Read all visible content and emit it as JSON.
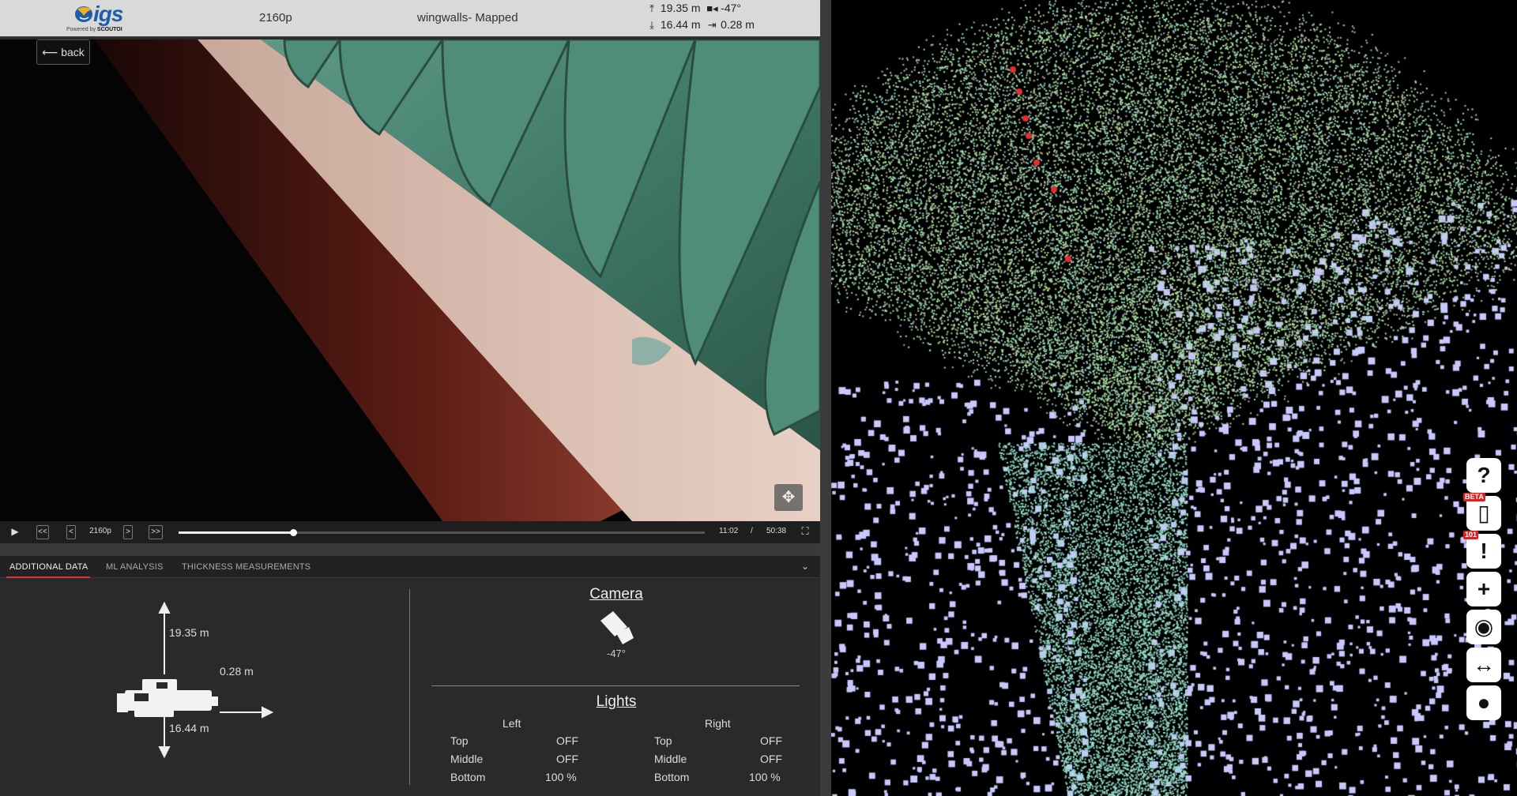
{
  "topbar": {
    "logo_text": "igs",
    "logo_sub_prefix": "Powered by ",
    "logo_sub_brand": "SCOUTOI",
    "resolution": "2160p",
    "title": "wingwalls- Mapped",
    "stats": {
      "up": "19.35 m",
      "camera_angle": "-47°",
      "down": "16.44 m",
      "side": "0.28 m"
    }
  },
  "video": {
    "back_label": "back",
    "move_icon": "move-icon"
  },
  "controls": {
    "play_icon": "▶",
    "rewind_label": "<<",
    "prev_label": "<",
    "resolution_label": "2160p",
    "next_label": ">",
    "forward_label": ">>",
    "progress_fraction": 0.217,
    "current_time": "11:02",
    "separator": "/",
    "total_time": "50:38",
    "fullscreen_icon": "fullscreen-icon"
  },
  "tabs": [
    {
      "label": "ADDITIONAL DATA",
      "active": true
    },
    {
      "label": "ML ANALYSIS",
      "active": false
    },
    {
      "label": "THICKNESS MEASUREMENTS",
      "active": false
    }
  ],
  "additional_data": {
    "up_distance": "19.35 m",
    "side_distance": "0.28 m",
    "down_distance": "16.44 m",
    "camera_title": "Camera",
    "camera_angle": "-47°",
    "lights_title": "Lights",
    "lights": {
      "left_header": "Left",
      "right_header": "Right",
      "left": [
        {
          "name": "Top",
          "value": "OFF"
        },
        {
          "name": "Middle",
          "value": "OFF"
        },
        {
          "name": "Bottom",
          "value": "100 %"
        }
      ],
      "right": [
        {
          "name": "Top",
          "value": "OFF"
        },
        {
          "name": "Middle",
          "value": "OFF"
        },
        {
          "name": "Bottom",
          "value": "100 %"
        }
      ]
    }
  },
  "pointcloud_toolbar": [
    {
      "icon": "help-icon",
      "glyph": "?",
      "badge": ""
    },
    {
      "icon": "map-icon",
      "glyph": "▯",
      "badge": "BETA"
    },
    {
      "icon": "alert-icon",
      "glyph": "!",
      "badge": "101"
    },
    {
      "icon": "add-icon",
      "glyph": "+",
      "badge": ""
    },
    {
      "icon": "eye-icon",
      "glyph": "◉",
      "badge": ""
    },
    {
      "icon": "measure-icon",
      "glyph": "↔",
      "badge": ""
    },
    {
      "icon": "toggle-icon",
      "glyph": "●",
      "badge": ""
    }
  ],
  "colors": {
    "accent_red": "#d43a3a",
    "logo_blue": "#1d5ea8",
    "point_cloud_green": "#a8e0b0",
    "point_cloud_lavender": "#c8c8ff"
  }
}
